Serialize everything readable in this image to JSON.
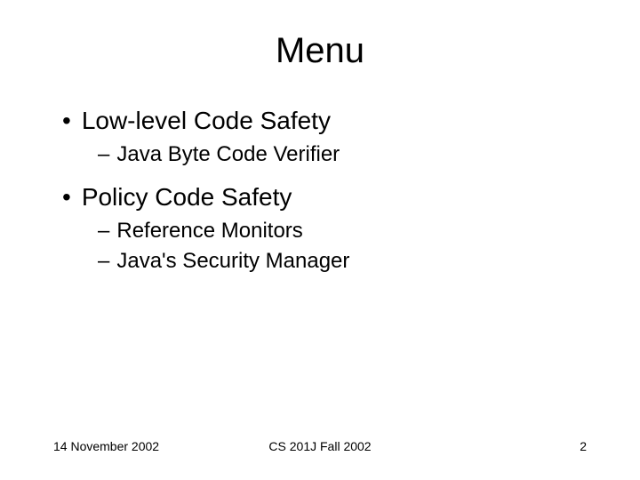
{
  "slide": {
    "title": "Menu",
    "bullets": {
      "item1": "Low-level Code Safety",
      "item1_sub1": "Java Byte Code Verifier",
      "item2": "Policy Code Safety",
      "item2_sub1": "Reference Monitors",
      "item2_sub2": "Java's Security Manager"
    },
    "markers": {
      "dot": "•",
      "dash": "–"
    }
  },
  "footer": {
    "date": "14 November 2002",
    "course": "CS 201J Fall 2002",
    "page": "2"
  }
}
